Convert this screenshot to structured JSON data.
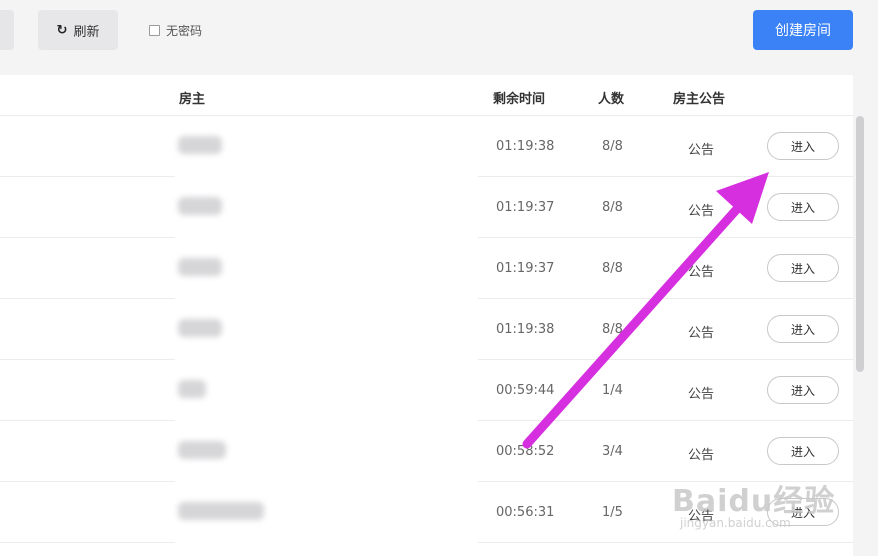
{
  "toolbar": {
    "refresh_icon": "↻",
    "refresh_label": "刷新",
    "no_password_label": "无密码",
    "create_room_label": "创建房间"
  },
  "table": {
    "headers": {
      "owner": "房主",
      "remaining_time": "剩余时间",
      "players": "人数",
      "owner_notice": "房主公告"
    },
    "rows": [
      {
        "time": "01:19:38",
        "players": "8/8",
        "notice": "公告",
        "action": "进入"
      },
      {
        "time": "01:19:37",
        "players": "8/8",
        "notice": "公告",
        "action": "进入"
      },
      {
        "time": "01:19:37",
        "players": "8/8",
        "notice": "公告",
        "action": "进入"
      },
      {
        "time": "01:19:38",
        "players": "8/8",
        "notice": "公告",
        "action": "进入"
      },
      {
        "time": "00:59:44",
        "players": "1/4",
        "notice": "公告",
        "action": "进入"
      },
      {
        "time": "00:58:52",
        "players": "3/4",
        "notice": "公告",
        "action": "进入"
      },
      {
        "time": "00:56:31",
        "players": "1/5",
        "notice": "公告",
        "action": "进入"
      }
    ]
  },
  "watermark": {
    "main": "Baidu经验",
    "sub": "jingyan.baidu.com"
  },
  "colors": {
    "accent": "#3b82f6",
    "annotation_arrow": "#d62fe0"
  }
}
